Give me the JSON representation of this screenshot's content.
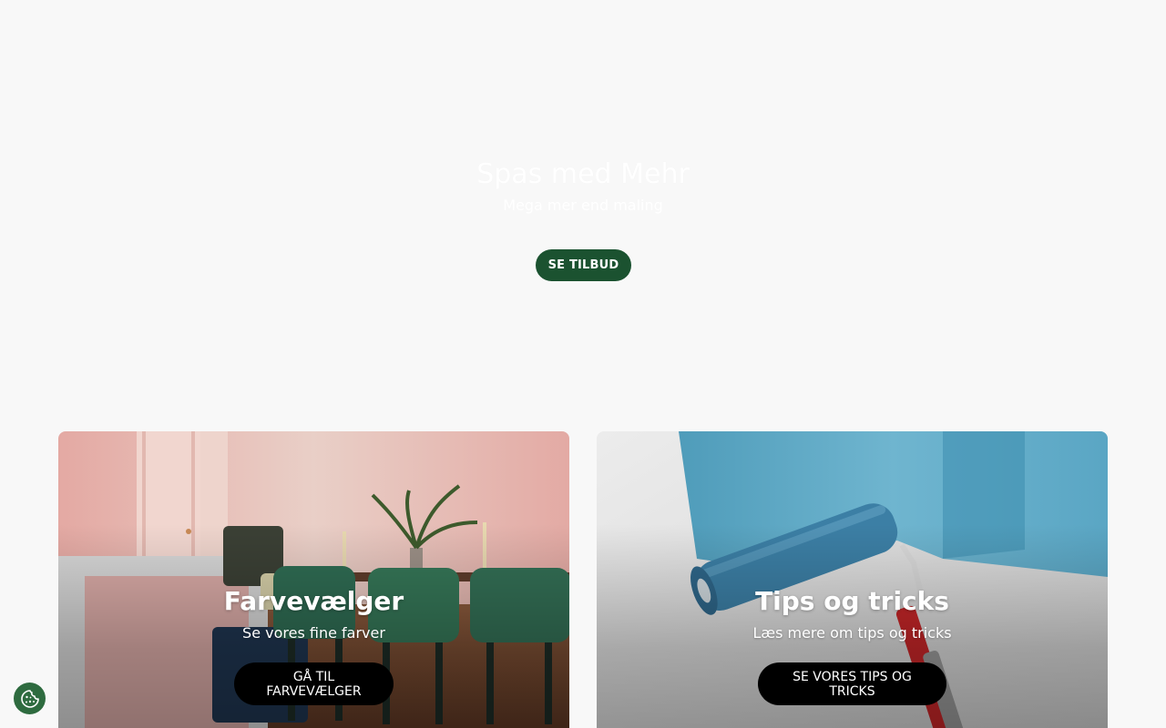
{
  "hero": {
    "title": "Spas med Mehr",
    "subtitle": "Mega mer end maling",
    "button_label": "SE TILBUD"
  },
  "cards": [
    {
      "title": "Farvevælger",
      "subtitle": "Se vores fine farver",
      "button_label": "GÅ TIL FARVEVÆLGER"
    },
    {
      "title": "Tips og tricks",
      "subtitle": "Læs mere om tips og tricks",
      "button_label": "SE VORES TIPS OG TRICKS"
    }
  ],
  "cookie": {
    "icon": "cookie-icon"
  },
  "colors": {
    "background": "#f8f8f8",
    "primary_green": "#1b5230",
    "cookie_green": "#2e6b3f",
    "card_button": "#000000"
  }
}
